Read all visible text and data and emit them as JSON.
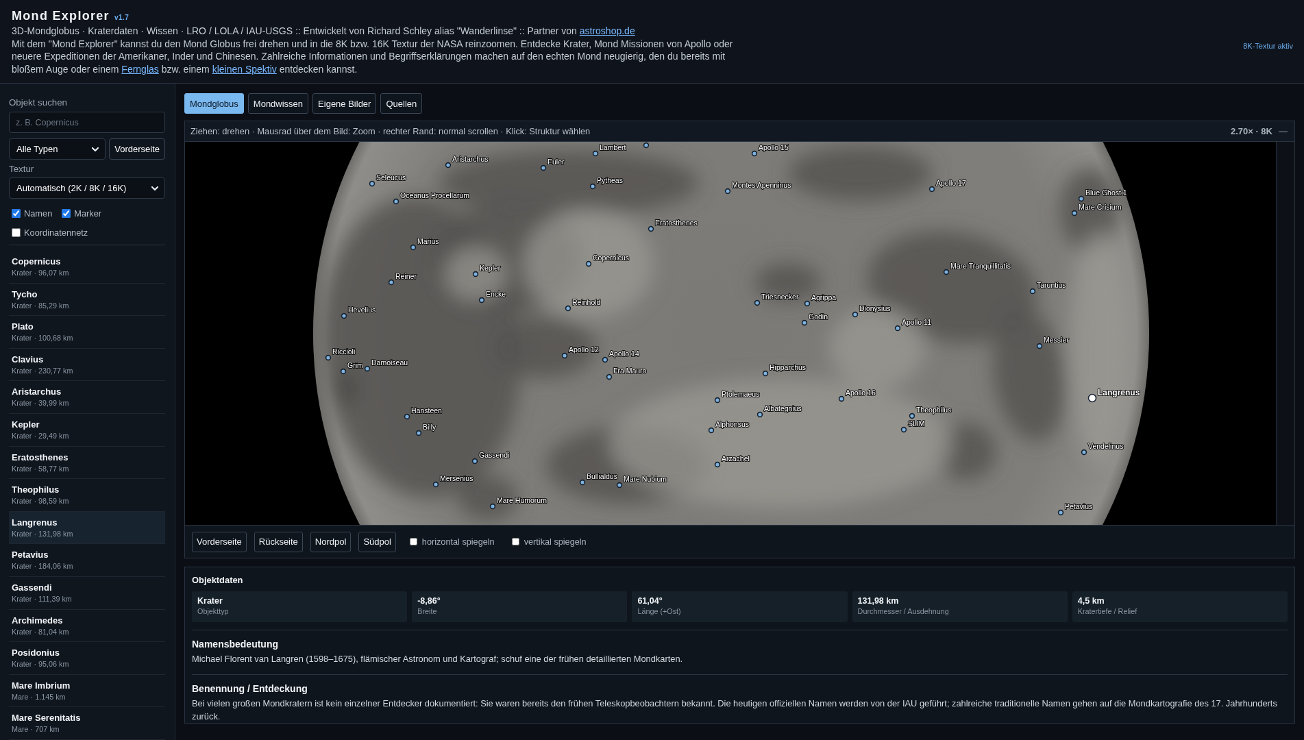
{
  "header": {
    "title": "Mond Explorer",
    "version": "v1.7",
    "subtitle": [
      {
        "kind": "text",
        "text": "3D-Mondglobus · Kraterdaten · Wissen · LRO / LOLA / IAU-USGS :: Entwickelt von Richard Schley alias \"Wanderlinse\" :: Partner von "
      },
      {
        "kind": "link",
        "text": "astroshop.de"
      }
    ],
    "description": [
      {
        "kind": "text",
        "text": "Mit dem \"Mond Explorer\" kannst du den Mond Globus frei drehen und in die 8K bzw. 16K Textur der NASA reinzoomen. Entdecke Krater, Mond Missionen von Apollo oder neuere Expeditionen der Amerikaner, Inder und Chinesen. Zahlreiche Informationen und Begriffserklärungen machen auf den echten Mond neugierig, den du bereits mit bloßem Auge oder einem "
      },
      {
        "kind": "link",
        "text": "Fernglas"
      },
      {
        "kind": "text",
        "text": " bzw. einem "
      },
      {
        "kind": "link",
        "text": "kleinen Spektiv"
      },
      {
        "kind": "text",
        "text": " entdecken kannst."
      }
    ],
    "texture_status": "8K-Textur aktiv"
  },
  "sidebar": {
    "search": {
      "label": "Objekt suchen",
      "placeholder": "z. B. Copernicus"
    },
    "type_filter": {
      "value": "Alle Typen"
    },
    "side_button": "Vorderseite",
    "texture": {
      "label": "Textur",
      "value": "Automatisch (2K / 8K / 16K)"
    },
    "toggles": [
      {
        "label": "Namen",
        "checked": true
      },
      {
        "label": "Marker",
        "checked": true
      },
      {
        "label": "Koordinatennetz",
        "checked": false
      }
    ],
    "objects": [
      {
        "name": "Copernicus",
        "info": "Krater · 96,07 km",
        "selected": false
      },
      {
        "name": "Tycho",
        "info": "Krater · 85,29 km",
        "selected": false
      },
      {
        "name": "Plato",
        "info": "Krater · 100,68 km",
        "selected": false
      },
      {
        "name": "Clavius",
        "info": "Krater · 230,77 km",
        "selected": false
      },
      {
        "name": "Aristarchus",
        "info": "Krater · 39,99 km",
        "selected": false
      },
      {
        "name": "Kepler",
        "info": "Krater · 29,49 km",
        "selected": false
      },
      {
        "name": "Eratosthenes",
        "info": "Krater · 58,77 km",
        "selected": false
      },
      {
        "name": "Theophilus",
        "info": "Krater · 98,59 km",
        "selected": false
      },
      {
        "name": "Langrenus",
        "info": "Krater · 131,98 km",
        "selected": true
      },
      {
        "name": "Petavius",
        "info": "Krater · 184,06 km",
        "selected": false
      },
      {
        "name": "Gassendi",
        "info": "Krater · 111,39 km",
        "selected": false
      },
      {
        "name": "Archimedes",
        "info": "Krater · 81,04 km",
        "selected": false
      },
      {
        "name": "Posidonius",
        "info": "Krater · 95,06 km",
        "selected": false
      },
      {
        "name": "Mare Imbrium",
        "info": "Mare · 1.145 km",
        "selected": false
      },
      {
        "name": "Mare Serenitatis",
        "info": "Mare · 707 km",
        "selected": false
      }
    ]
  },
  "tabs": [
    {
      "label": "Mondglobus",
      "selected": true
    },
    {
      "label": "Mondwissen",
      "selected": false
    },
    {
      "label": "Eigene Bilder",
      "selected": false
    },
    {
      "label": "Quellen",
      "selected": false
    }
  ],
  "viewer": {
    "hint": "Ziehen: drehen · Mausrad über dem Bild: Zoom · rechter Rand: normal scrollen · Klick: Struktur wählen",
    "zoom_info": "2.70× · 8K",
    "collapse": "—",
    "markers": [
      {
        "label": "Lambert",
        "selected": false
      },
      {
        "selected": false
      },
      {
        "label": "Apollo 15",
        "selected": false
      },
      {
        "label": "Aristarchus",
        "selected": false
      },
      {
        "label": "Euler",
        "selected": false
      },
      {
        "label": "Seleucus",
        "selected": false
      },
      {
        "label": "Pytheas",
        "selected": false
      },
      {
        "label": "Montes Apenninus",
        "selected": false
      },
      {
        "label": "Apollo 17",
        "selected": false
      },
      {
        "label": "Oceanus Procellarum",
        "selected": false
      },
      {
        "label": "Blue Ghost 1",
        "selected": false
      },
      {
        "label": "Mare Crisium",
        "selected": false
      },
      {
        "label": "Eratosthenes",
        "selected": false
      },
      {
        "label": "Marius",
        "selected": false
      },
      {
        "label": "Copernicus",
        "selected": false
      },
      {
        "label": "Kepler",
        "selected": false
      },
      {
        "label": "Mare Tranquillitatis",
        "selected": false
      },
      {
        "label": "Reiner",
        "selected": false
      },
      {
        "label": "Taruntius",
        "selected": false
      },
      {
        "label": "Encke",
        "selected": false
      },
      {
        "label": "Triesnecker",
        "selected": false
      },
      {
        "label": "Agrippa",
        "selected": false
      },
      {
        "label": "Reinhold",
        "selected": false
      },
      {
        "label": "Hevelius",
        "selected": false
      },
      {
        "label": "Dionysius",
        "selected": false
      },
      {
        "label": "Godin",
        "selected": false
      },
      {
        "label": "Apollo 11",
        "selected": false
      },
      {
        "label": "Messier",
        "selected": false
      },
      {
        "label": "Riccioli",
        "selected": false
      },
      {
        "label": "Apollo 12",
        "selected": false
      },
      {
        "label": "Apollo 14",
        "selected": false
      },
      {
        "label": "Grim",
        "selected": false
      },
      {
        "label": "Damoiseau",
        "selected": false
      },
      {
        "label": "Fra Mauro",
        "selected": false
      },
      {
        "label": "Hipparchus",
        "selected": false
      },
      {
        "label": "Ptolemaeus",
        "selected": false
      },
      {
        "label": "Apollo 16",
        "selected": false
      },
      {
        "label": "Langrenus",
        "selected": true
      },
      {
        "label": "Hansteen",
        "selected": false
      },
      {
        "label": "Albategnius",
        "selected": false
      },
      {
        "label": "Theophilus",
        "selected": false
      },
      {
        "label": "Billy",
        "selected": false
      },
      {
        "label": "Alphonsus",
        "selected": false
      },
      {
        "label": "SLIM",
        "selected": false
      },
      {
        "label": "Vendelinus",
        "selected": false
      },
      {
        "label": "Gassendi",
        "selected": false
      },
      {
        "label": "Arzachel",
        "selected": false
      },
      {
        "label": "Mersenius",
        "selected": false
      },
      {
        "label": "Bullialdus",
        "selected": false
      },
      {
        "label": "Mare Nubium",
        "selected": false
      },
      {
        "label": "Mare Humorum",
        "selected": false
      },
      {
        "label": "Petavius",
        "selected": false
      }
    ]
  },
  "view_controls": {
    "buttons": [
      "Vorderseite",
      "Rückseite",
      "Nordpol",
      "Südpol"
    ],
    "toggles": [
      {
        "label": "horizontal spiegeln",
        "checked": false
      },
      {
        "label": "vertikal spiegeln",
        "checked": false
      }
    ]
  },
  "details": {
    "title": "Objektdaten",
    "stats": [
      {
        "value": "Krater",
        "label": "Objekttyp"
      },
      {
        "value": "-8,86°",
        "label": "Breite"
      },
      {
        "value": "61,04°",
        "label": "Länge (+Ost)"
      },
      {
        "value": "131,98 km",
        "label": "Durchmesser / Ausdehnung"
      },
      {
        "value": "4,5 km",
        "label": "Kratertiefe / Relief"
      }
    ],
    "sections": [
      {
        "heading": "Namensbedeutung",
        "text": "Michael Florent van Langren (1598–1675), flämischer Astronom und Kartograf; schuf eine der frühen detaillierten Mondkarten."
      },
      {
        "heading": "Benennung / Entdeckung",
        "text": "Bei vielen großen Mondkratern ist kein einzelner Entdecker dokumentiert: Sie waren bereits den frühen Teleskopbeobachtern bekannt. Die heutigen offiziellen Namen werden von der IAU geführt; zahlreiche traditionelle Namen gehen auf die Mondkartografie des 17. Jahrhunderts zurück."
      }
    ]
  }
}
